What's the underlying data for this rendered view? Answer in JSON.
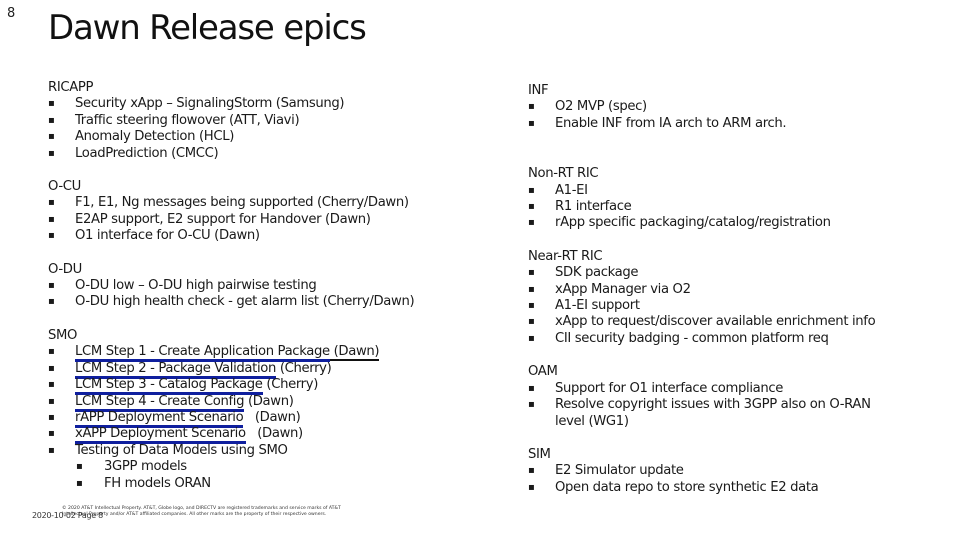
{
  "slide": {
    "page_number": "8",
    "title": "Dawn Release epics"
  },
  "left_sections": [
    {
      "title": "RICAPP",
      "items": [
        {
          "text": "Security xApp – SignalingStorm (Samsung)"
        },
        {
          "text": "Traffic steering flowover (ATT, Viavi)"
        },
        {
          "text": "Anomaly Detection (HCL)"
        },
        {
          "text": "LoadPrediction (CMCC)"
        }
      ]
    },
    {
      "title": "O-CU",
      "items": [
        {
          "text": "F1, E1, Ng messages being supported (Cherry/Dawn)"
        },
        {
          "text": "E2AP support, E2 support for Handover (Dawn)"
        },
        {
          "text": "O1 interface for O-CU (Dawn)"
        }
      ]
    },
    {
      "title": "O-DU",
      "items": [
        {
          "text": "O-DU low – O-DU high pairwise testing"
        },
        {
          "text": "O-DU high health check - get alarm list (Cherry/Dawn)"
        }
      ]
    },
    {
      "title": "SMO",
      "items": [
        {
          "link": "LCM Step 1 - Create Application Package",
          "suffix": " (Dawn)"
        },
        {
          "link": "LCM Step 2 - Package Validation",
          "suffix": " (Cherry)"
        },
        {
          "link": "LCM Step 3 - Catalog Package",
          "suffix": " (Cherry)"
        },
        {
          "link": "LCM Step 4 - Create Config",
          "suffix": " (Dawn)"
        },
        {
          "link": "rAPP Deployment Scenario",
          "suffix": "   (Dawn)"
        },
        {
          "link": "xAPP Deployment Scenario",
          "suffix": "   (Dawn)"
        },
        {
          "text": "Testing of Data Models using SMO"
        }
      ],
      "sub_items": [
        {
          "text": "3GPP models"
        },
        {
          "text": "FH models ORAN"
        }
      ]
    }
  ],
  "right_sections": [
    {
      "title": "INF",
      "items": [
        {
          "text": "O2 MVP (spec)"
        },
        {
          "text": "Enable INF from IA arch to ARM arch."
        }
      ]
    },
    {
      "title": "Non-RT RIC",
      "items": [
        {
          "text": "A1-EI"
        },
        {
          "text": "R1 interface"
        },
        {
          "text": "rApp specific packaging/catalog/registration"
        }
      ]
    },
    {
      "title": "Near-RT RIC",
      "items": [
        {
          "text": "SDK package"
        },
        {
          "text": "xApp Manager via O2"
        },
        {
          "text": "A1-EI support"
        },
        {
          "text": "xApp to request/discover available enrichment info"
        },
        {
          "text": "CII security badging - common platform req"
        }
      ]
    },
    {
      "title": "OAM",
      "items": [
        {
          "text": "Support for O1 interface compliance"
        },
        {
          "text": "Resolve copyright issues with 3GPP also on O-RAN level (WG1)"
        }
      ]
    },
    {
      "title": "SIM",
      "items": [
        {
          "text": "E2 Simulator update"
        },
        {
          "text": "Open data repo to store synthetic E2 data"
        }
      ]
    }
  ],
  "footer": {
    "date_page": "2020-10-02  Page 8",
    "legal": "© 2020 AT&T Intellectual Property. AT&T, Globe logo, and DIRECTV are registered trademarks and service marks of AT&T Intellectual Property and/or AT&T affiliated companies. All other marks are the property of their respective owners."
  },
  "bullet_glyph": "▪",
  "colors": {
    "link_underline": "#0f1f9e",
    "text": "#1a1a1a"
  }
}
